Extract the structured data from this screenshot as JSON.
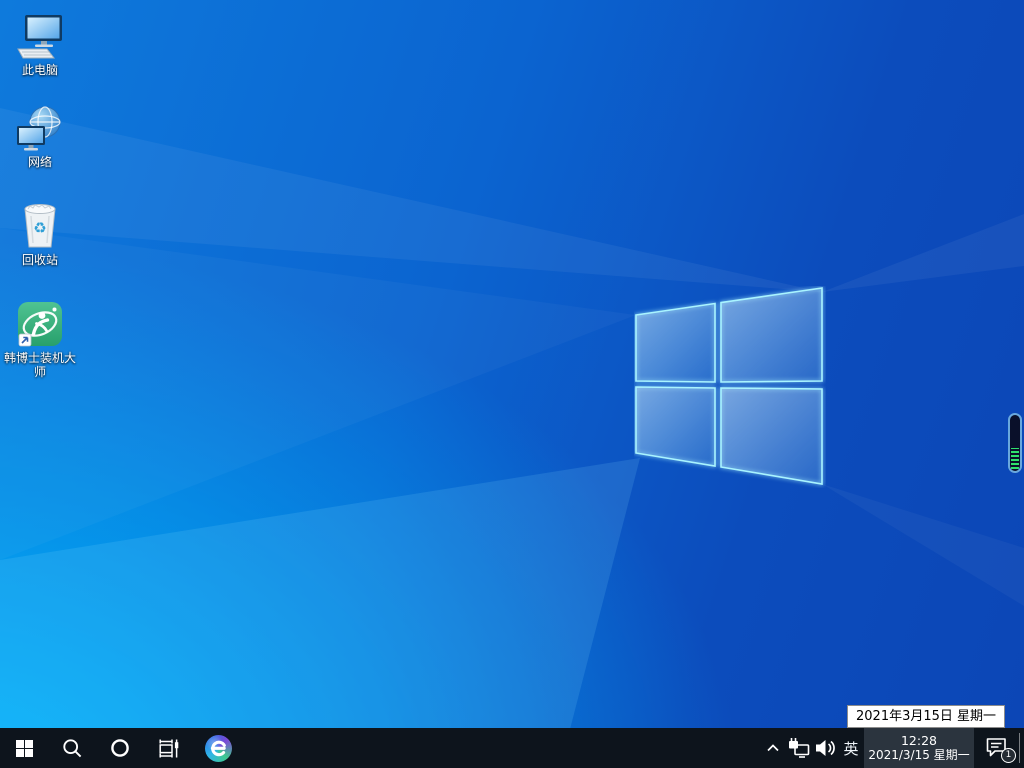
{
  "desktop": {
    "icons": [
      {
        "label": "此电脑"
      },
      {
        "label": "网络"
      },
      {
        "label": "回收站"
      },
      {
        "label": "韩博士装机大师"
      }
    ]
  },
  "taskbar": {
    "tray": {
      "ime": "英",
      "time": "12:28",
      "date": "2021/3/15 星期一",
      "notification_count": "1"
    }
  },
  "tooltip": {
    "text": "2021年3月15日 星期一"
  },
  "icons": {
    "start": "windows-logo",
    "search": "magnifier",
    "cortana": "ring",
    "task_view": "timeline-filmstrip",
    "edge": "edge-browser",
    "tray": [
      "chevron-up",
      "ethernet-network",
      "speaker-volume",
      "notification-bubble"
    ],
    "desktop": [
      "monitor-keyboard",
      "globe-monitor",
      "recycle-bin",
      "green-app-shortcut"
    ]
  },
  "colors": {
    "wallpaper_deep_blue": "#0c46b6",
    "wallpaper_bright_cyan": "#00aaf2",
    "window_pane_border": "#a9f4ff",
    "taskbar_background": "#0d141c",
    "clock_hover_background": "#2b343e",
    "indicator_fill_green": "#2fe06c",
    "indicator_border": "#69a8de",
    "hanboshi_green": "#38b27e"
  }
}
